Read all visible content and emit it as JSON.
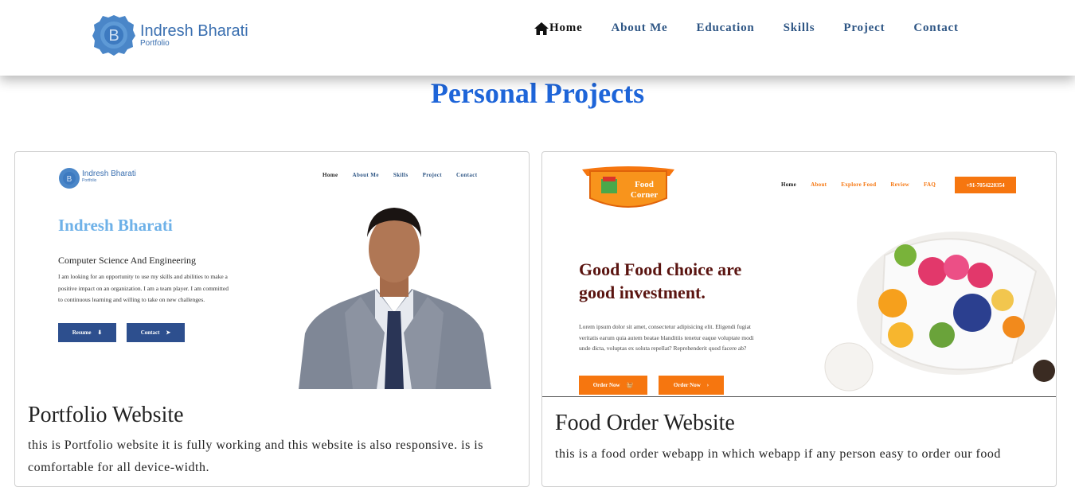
{
  "header": {
    "logo_letter": "B",
    "logo_name": "Indresh Bharati",
    "logo_sub": "Portfolio",
    "nav": [
      "Home",
      "About Me",
      "Education",
      "Skills",
      "Project",
      "Contact"
    ]
  },
  "section": {
    "title": "Personal Projects"
  },
  "projects": [
    {
      "title": "Portfolio Website",
      "description": "this is Portfolio website it is fully working and this website is also responsive. is is comfortable for all device-width.",
      "preview": {
        "logo_name": "Indresh Bharati",
        "logo_sub": "Portfolio",
        "nav": [
          "Home",
          "About Me",
          "Skills",
          "Project",
          "Contact"
        ],
        "heading": "Indresh Bharati",
        "subheading": "Computer Science And Engineering",
        "text": "I am looking for an opportunity to use my skills and abilities to make a positive impact on an organization. I am a team player. I am committed to continuous learning and willing to take on new challenges.",
        "buttons": [
          "Resume",
          "Contact"
        ]
      }
    },
    {
      "title": "Food Order Website",
      "description": "this is a food order webapp in which webapp if any person easy to order our food",
      "preview": {
        "logo_text": "Food Corner",
        "nav": [
          "Home",
          "About",
          "Explore Food",
          "Review",
          "FAQ"
        ],
        "phone": "+91-7054220354",
        "heading": "Good Food choice are good investment.",
        "text": "Lorem ipsum dolor sit amet, consectetur adipisicing elit. Eligendi fugiat veritatis earum quia autem beatae blanditiis tenetur eaque voluptate modi unde dicta, voluptas ex soluta repellat? Reprehenderit quod facere ab?",
        "buttons": [
          "Order Now",
          "Order Now"
        ]
      }
    }
  ],
  "colors": {
    "accent": "#1e65d9",
    "nav": "#2d5584",
    "food_orange": "#f6760f",
    "food_dark": "#5a1410"
  }
}
